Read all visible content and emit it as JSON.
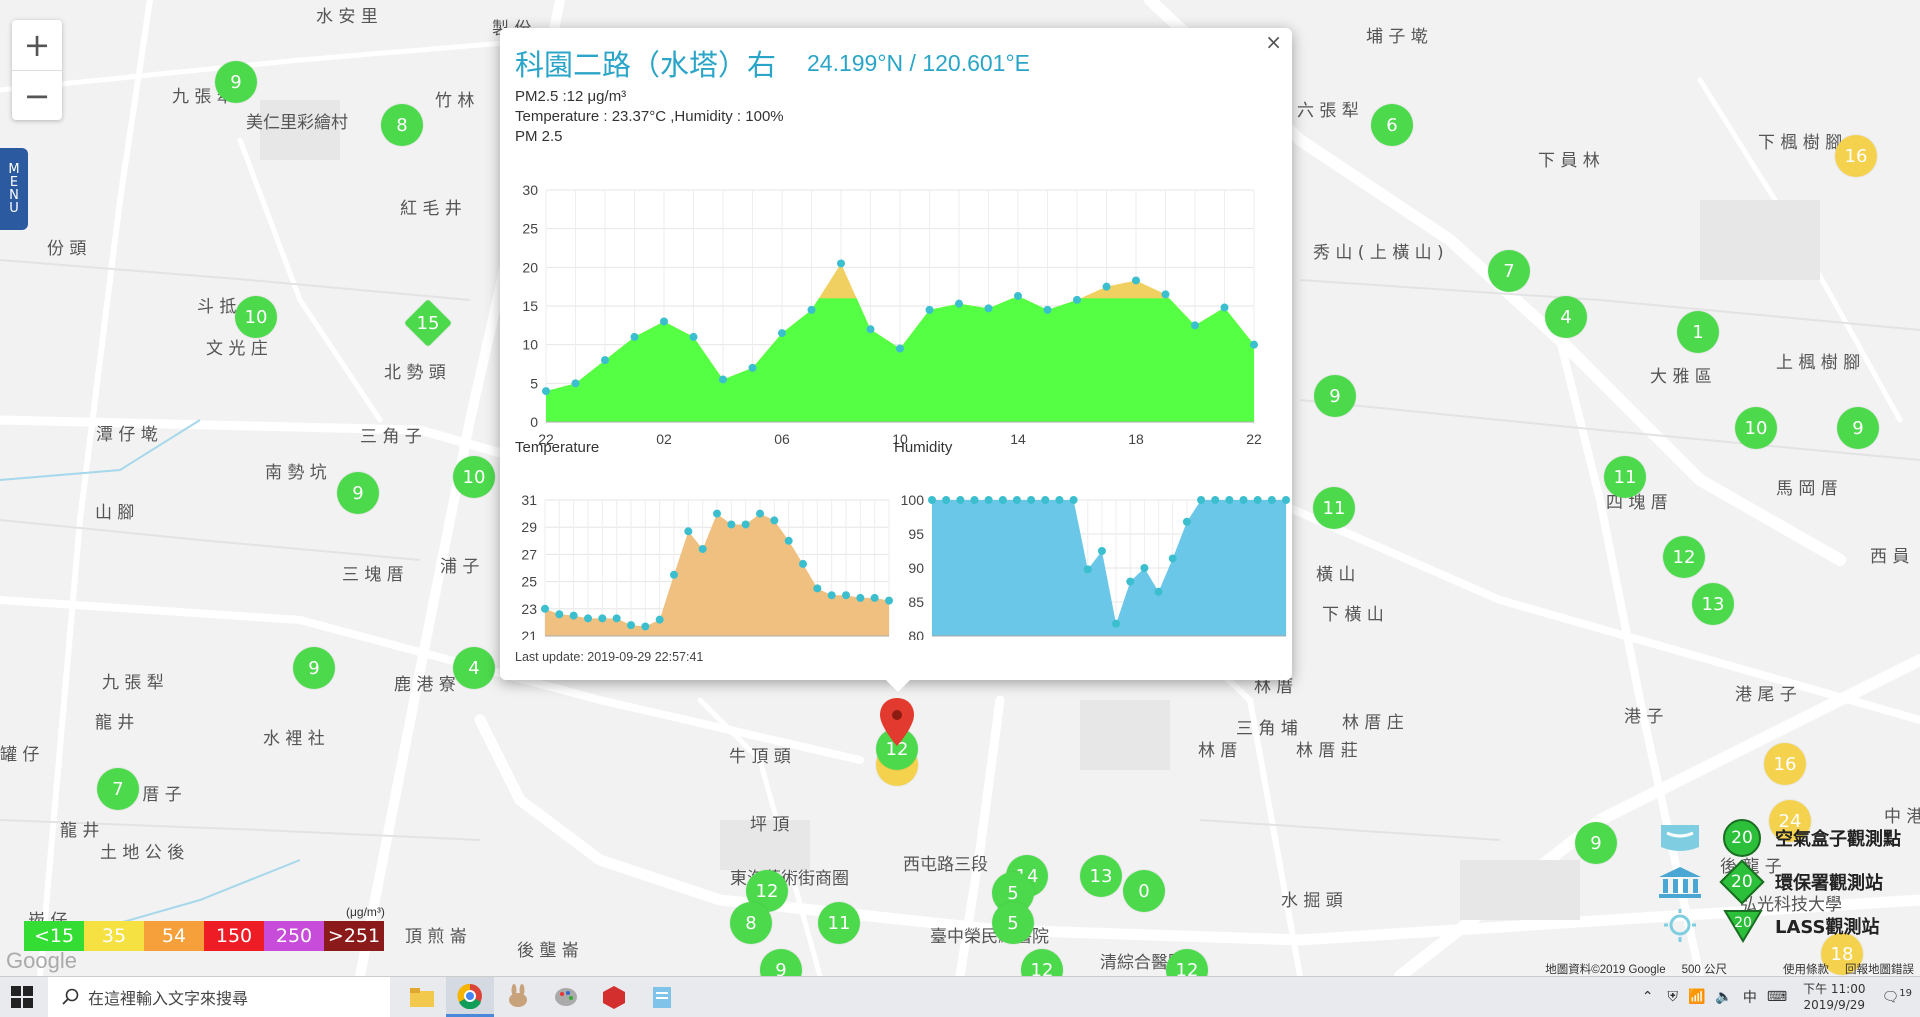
{
  "map": {
    "zoom_in": "+",
    "zoom_out": "−",
    "menu_letters": [
      "M",
      "E",
      "N",
      "U"
    ],
    "places": [
      {
        "t": "水 安 里",
        "x": 316,
        "y": 2
      },
      {
        "t": "製 份",
        "x": 492,
        "y": 14
      },
      {
        "t": "埔 子 墘",
        "x": 1366,
        "y": 22
      },
      {
        "t": "九 張 犁",
        "x": 172,
        "y": 82
      },
      {
        "t": "竹 林",
        "x": 435,
        "y": 86
      },
      {
        "t": "美仁里彩繪村",
        "x": 246,
        "y": 108
      },
      {
        "t": "六 張 犁",
        "x": 1297,
        "y": 96
      },
      {
        "t": "下 楓 樹 腳",
        "x": 1758,
        "y": 128
      },
      {
        "t": "下 員 林",
        "x": 1538,
        "y": 146
      },
      {
        "t": "紅 毛 井",
        "x": 400,
        "y": 194
      },
      {
        "t": "份 頭",
        "x": 47,
        "y": 234
      },
      {
        "t": "秀 山 ( 上 橫 山 )",
        "x": 1313,
        "y": 238
      },
      {
        "t": "斗 抵",
        "x": 197,
        "y": 292
      },
      {
        "t": "文 光 庄",
        "x": 206,
        "y": 334
      },
      {
        "t": "北 勢 頭",
        "x": 384,
        "y": 358
      },
      {
        "t": "大 雅 區",
        "x": 1650,
        "y": 362
      },
      {
        "t": "上 楓 樹 腳",
        "x": 1776,
        "y": 348
      },
      {
        "t": "潭 仔 墘",
        "x": 96,
        "y": 420
      },
      {
        "t": "三 角 子",
        "x": 360,
        "y": 422
      },
      {
        "t": "南 勢 坑",
        "x": 265,
        "y": 458
      },
      {
        "t": "馬 岡 厝",
        "x": 1776,
        "y": 474
      },
      {
        "t": "山 腳",
        "x": 95,
        "y": 498
      },
      {
        "t": "四 塊 厝",
        "x": 1606,
        "y": 488
      },
      {
        "t": "浦 子",
        "x": 440,
        "y": 552
      },
      {
        "t": "三 塊 厝",
        "x": 342,
        "y": 560
      },
      {
        "t": "橫 山",
        "x": 1316,
        "y": 560
      },
      {
        "t": "西 員",
        "x": 1870,
        "y": 542
      },
      {
        "t": "下 橫 山",
        "x": 1322,
        "y": 600
      },
      {
        "t": "九 張 犁",
        "x": 102,
        "y": 668
      },
      {
        "t": "鹿 港 寮",
        "x": 394,
        "y": 670
      },
      {
        "t": "港 子",
        "x": 1624,
        "y": 702
      },
      {
        "t": "港 尾 子",
        "x": 1735,
        "y": 680
      },
      {
        "t": "龍 井",
        "x": 95,
        "y": 708
      },
      {
        "t": "水 裡 社",
        "x": 263,
        "y": 724
      },
      {
        "t": "林 厝",
        "x": 1254,
        "y": 672
      },
      {
        "t": "三 角 埔",
        "x": 1236,
        "y": 714
      },
      {
        "t": "林 厝 庄",
        "x": 1342,
        "y": 708
      },
      {
        "t": "牛 頂 頭",
        "x": 729,
        "y": 742
      },
      {
        "t": "林 厝",
        "x": 1198,
        "y": 736
      },
      {
        "t": "林 厝 莊",
        "x": 1296,
        "y": 736
      },
      {
        "t": "七 厝 子",
        "x": 120,
        "y": 780
      },
      {
        "t": "坪 頂",
        "x": 750,
        "y": 810
      },
      {
        "t": "龍 井",
        "x": 60,
        "y": 816
      },
      {
        "t": "土 地 公 後",
        "x": 100,
        "y": 838
      },
      {
        "t": "後 龍 子",
        "x": 1720,
        "y": 852
      },
      {
        "t": "中 港",
        "x": 1884,
        "y": 802
      },
      {
        "t": "東海藝術街商圈",
        "x": 730,
        "y": 864
      },
      {
        "t": "西屯路三段",
        "x": 903,
        "y": 850
      },
      {
        "t": "弘光科技大學",
        "x": 1740,
        "y": 890
      },
      {
        "t": "水 掘 頭",
        "x": 1281,
        "y": 886
      },
      {
        "t": "頂 煎 崙",
        "x": 405,
        "y": 922
      },
      {
        "t": "後 壟 崙",
        "x": 517,
        "y": 936
      },
      {
        "t": "臺中榮民總醫院",
        "x": 930,
        "y": 922
      },
      {
        "t": "清綜合醫院中",
        "x": 1100,
        "y": 948
      },
      {
        "t": "崁 仔",
        "x": 28,
        "y": 906
      },
      {
        "t": "罐 仔",
        "x": 0,
        "y": 740
      }
    ],
    "markers": [
      {
        "v": "9",
        "x": 236,
        "y": 82,
        "c": "#4cd94c"
      },
      {
        "v": "8",
        "x": 402,
        "y": 125,
        "c": "#4cd94c"
      },
      {
        "v": "10",
        "x": 256,
        "y": 317,
        "c": "#4cd94c"
      },
      {
        "v": "15",
        "x": 428,
        "y": 323,
        "c": "#4cd94c",
        "shape": "diamond"
      },
      {
        "v": "9",
        "x": 358,
        "y": 493,
        "c": "#4cd94c"
      },
      {
        "v": "10",
        "x": 474,
        "y": 477,
        "c": "#4cd94c"
      },
      {
        "v": "9",
        "x": 314,
        "y": 668,
        "c": "#4cd94c"
      },
      {
        "v": "4",
        "x": 474,
        "y": 668,
        "c": "#4cd94c"
      },
      {
        "v": "7",
        "x": 118,
        "y": 789,
        "c": "#4cd94c"
      },
      {
        "v": "6",
        "x": 1392,
        "y": 125,
        "c": "#4cd94c"
      },
      {
        "v": "16",
        "x": 1856,
        "y": 156,
        "c": "#f5d24e"
      },
      {
        "v": "7",
        "x": 1509,
        "y": 271,
        "c": "#4cd94c"
      },
      {
        "v": "4",
        "x": 1566,
        "y": 317,
        "c": "#4cd94c"
      },
      {
        "v": "1",
        "x": 1698,
        "y": 332,
        "c": "#4cd94c"
      },
      {
        "v": "9",
        "x": 1335,
        "y": 396,
        "c": "#4cd94c"
      },
      {
        "v": "10",
        "x": 1756,
        "y": 428,
        "c": "#4cd94c"
      },
      {
        "v": "9",
        "x": 1858,
        "y": 428,
        "c": "#4cd94c"
      },
      {
        "v": "11",
        "x": 1625,
        "y": 477,
        "c": "#4cd94c"
      },
      {
        "v": "11",
        "x": 1334,
        "y": 508,
        "c": "#4cd94c"
      },
      {
        "v": "12",
        "x": 1684,
        "y": 557,
        "c": "#4cd94c"
      },
      {
        "v": "13",
        "x": 1713,
        "y": 604,
        "c": "#4cd94c"
      },
      {
        "v": "16",
        "x": 1785,
        "y": 764,
        "c": "#f5d24e"
      },
      {
        "v": "24",
        "x": 1790,
        "y": 821,
        "c": "#f5d24e"
      },
      {
        "v": "9",
        "x": 1596,
        "y": 843,
        "c": "#4cd94c"
      },
      {
        "v": "12",
        "x": 767,
        "y": 891,
        "c": "#4cd94c"
      },
      {
        "v": "8",
        "x": 751,
        "y": 923,
        "c": "#4cd94c"
      },
      {
        "v": "11",
        "x": 839,
        "y": 923,
        "c": "#4cd94c"
      },
      {
        "v": "14",
        "x": 1027,
        "y": 876,
        "c": "#4cd94c"
      },
      {
        "v": "5",
        "x": 1013,
        "y": 893,
        "c": "#4cd94c"
      },
      {
        "v": "5",
        "x": 1013,
        "y": 923,
        "c": "#4cd94c"
      },
      {
        "v": "13",
        "x": 1101,
        "y": 876,
        "c": "#4cd94c"
      },
      {
        "v": "0",
        "x": 1144,
        "y": 891,
        "c": "#4cd94c"
      },
      {
        "v": "9",
        "x": 781,
        "y": 970,
        "c": "#4cd94c"
      },
      {
        "v": "12",
        "x": 1042,
        "y": 970,
        "c": "#4cd94c"
      },
      {
        "v": "12",
        "x": 1187,
        "y": 970,
        "c": "#4cd94c"
      },
      {
        "v": "18",
        "x": 1842,
        "y": 954,
        "c": "#f5d24e"
      },
      {
        "v": "",
        "x": 897,
        "y": 765,
        "c": "#f5d24e"
      },
      {
        "v": "12",
        "x": 897,
        "y": 749,
        "c": "#4cd94c"
      }
    ]
  },
  "popup": {
    "close": "×",
    "title": "科園二路（水塔）右",
    "coords": "24.199°N / 120.601°E",
    "pm_line": "PM2.5 :12 μg/m³",
    "temp_line": "Temperature : 23.37°C ,Humidity : 100%",
    "pm_chart_label": "PM 2.5",
    "temp_chart_label": "Temperature",
    "hum_chart_label": "Humidity",
    "last_update": "Last update: 2019-09-29 22:57:41"
  },
  "chart_data": [
    {
      "type": "area",
      "title": "PM 2.5",
      "ylim": [
        0,
        30
      ],
      "yticks": [
        "0",
        "5",
        "10",
        "15",
        "20",
        "25",
        "30"
      ],
      "xticks": [
        "22",
        "02",
        "06",
        "10",
        "14",
        "18",
        "22"
      ],
      "values": [
        4,
        5,
        8,
        11,
        13,
        11,
        5.5,
        7,
        11.5,
        14.5,
        20.5,
        12,
        9.5,
        14.5,
        15.3,
        14.7,
        16.3,
        14.5,
        15.8,
        17.5,
        18.3,
        16.5,
        12.5,
        14.8,
        10
      ],
      "threshold": 16,
      "colors": {
        "fill_low": "#55ff44",
        "fill_high": "#f0d060",
        "point": "#3bbfcf"
      }
    },
    {
      "type": "area",
      "title": "Temperature",
      "ylim": [
        21,
        31
      ],
      "yticks": [
        "21",
        "23",
        "25",
        "27",
        "29",
        "31"
      ],
      "values": [
        23,
        22.6,
        22.5,
        22.3,
        22.3,
        22.3,
        21.8,
        21.7,
        22.2,
        25.5,
        28.7,
        27.4,
        30,
        29.2,
        29.2,
        30,
        29.5,
        28,
        26.3,
        24.5,
        24,
        24,
        23.8,
        23.8,
        23.6
      ],
      "colors": {
        "fill": "#f0c080",
        "point": "#3bbfcf"
      }
    },
    {
      "type": "area",
      "title": "Humidity",
      "ylim": [
        80,
        100
      ],
      "yticks": [
        "80",
        "85",
        "90",
        "95",
        "100"
      ],
      "values": [
        100,
        100,
        100,
        100,
        100,
        100,
        100,
        100,
        100,
        100,
        100,
        89.8,
        92.5,
        81.8,
        88,
        90,
        86.5,
        91.4,
        96.8,
        100,
        100,
        100,
        100,
        100,
        100,
        100
      ],
      "colors": {
        "fill": "#6ac7e8",
        "point": "#3bbfcf"
      }
    }
  ],
  "legend": {
    "unit": "(μg/m³)",
    "items": [
      {
        "label": "<15",
        "color": "#33dd33"
      },
      {
        "label": "35",
        "color": "#f5e142"
      },
      {
        "label": "54",
        "color": "#f5a03a"
      },
      {
        "label": "150",
        "color": "#ee1c25"
      },
      {
        "label": "250",
        "color": "#c64cd9"
      },
      {
        "label": ">251",
        "color": "#8b1a1a"
      }
    ]
  },
  "type_legend": [
    {
      "badge": "20",
      "label": "空氣盒子觀測點",
      "icon": "airbox-icon"
    },
    {
      "badge": "20",
      "label": "環保署觀測站",
      "icon": "epa-building-icon"
    },
    {
      "badge": "20",
      "label": "LASS觀測站",
      "icon": "lass-station-icon"
    }
  ],
  "google_logo": "Google",
  "attribution": [
    "地圖資料©2019 Google",
    "500 公尺",
    "使用條款",
    "回報地圖錯誤"
  ],
  "taskbar": {
    "search_placeholder": "在這裡輸入文字來搜尋",
    "clock_time": "下午 11:00",
    "clock_date": "2019/9/29",
    "ime": "中",
    "notif": "19"
  }
}
